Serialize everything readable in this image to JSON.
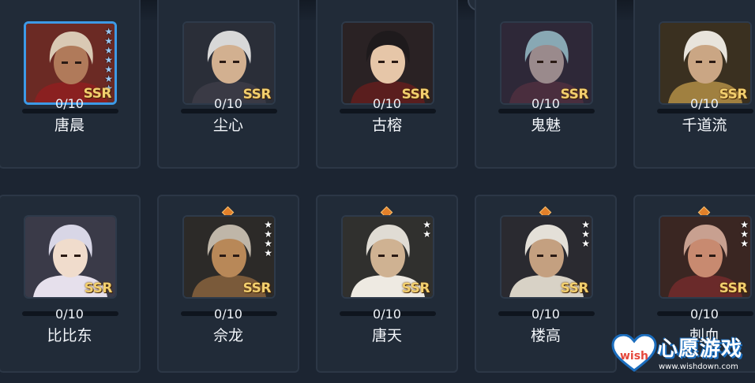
{
  "colors": {
    "background": "#1c2532",
    "card": "#212b38",
    "selected": "#3d9ae6",
    "ssr": "#f2cf6e",
    "gem": "#e2802a"
  },
  "characters": [
    {
      "name": "唐晨",
      "count": "0/10",
      "rarity": "SSR",
      "stars": 7,
      "star_color": "blue",
      "selected": true
    },
    {
      "name": "尘心",
      "count": "0/10",
      "rarity": "SSR",
      "stars": 0,
      "selected": false
    },
    {
      "name": "古榕",
      "count": "0/10",
      "rarity": "SSR",
      "stars": 0,
      "selected": false
    },
    {
      "name": "鬼魅",
      "count": "0/10",
      "rarity": "SSR",
      "stars": 0,
      "selected": false
    },
    {
      "name": "千道流",
      "count": "0/10",
      "rarity": "SSR",
      "stars": 0,
      "selected": false
    },
    {
      "name": "比比东",
      "count": "0/10",
      "rarity": "SSR",
      "stars": 0,
      "selected": false
    },
    {
      "name": "佘龙",
      "count": "0/10",
      "rarity": "SSR",
      "stars": 4,
      "star_color": "white",
      "gem": true,
      "selected": false
    },
    {
      "name": "唐天",
      "count": "0/10",
      "rarity": "SSR",
      "stars": 2,
      "star_color": "white",
      "gem": true,
      "selected": false
    },
    {
      "name": "楼高",
      "count": "0/10",
      "rarity": "SSR",
      "stars": 3,
      "star_color": "white",
      "gem": true,
      "selected": false
    },
    {
      "name": "刺血",
      "count": "0/10",
      "rarity": "SSR",
      "stars": 3,
      "star_color": "white",
      "gem": true,
      "selected": false
    }
  ],
  "watermark": {
    "text": "心愿游戏",
    "url": "www.wishdown.com",
    "logo": "wish"
  }
}
